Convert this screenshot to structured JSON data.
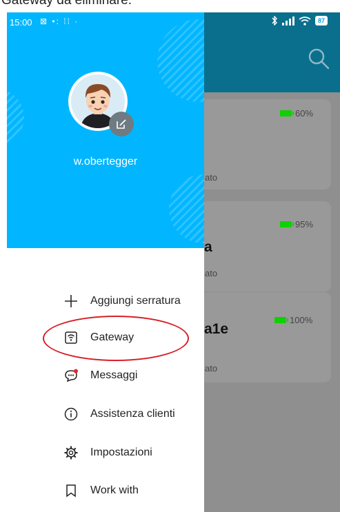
{
  "caption": {
    "text": "Gateway da eliminare."
  },
  "status_bar": {
    "time": "15:00",
    "left_icons": "⊠ •: ⁞⁞ ·",
    "battery": "87"
  },
  "background_cards": [
    {
      "battery_pct": "60%",
      "name_fragment": "",
      "status_fragment": "ato"
    },
    {
      "battery_pct": "95%",
      "name_fragment": "a",
      "status_fragment": "ato"
    },
    {
      "battery_pct": "100%",
      "name_fragment": "a1e",
      "status_fragment": "ato"
    }
  ],
  "drawer": {
    "username": "w.obertegger",
    "menu": [
      {
        "label": "Aggiungi serratura",
        "icon": "plus-icon"
      },
      {
        "label": "Gateway",
        "icon": "gateway-icon"
      },
      {
        "label": "Messaggi",
        "icon": "chat-bubble-icon"
      },
      {
        "label": "Assistenza clienti",
        "icon": "info-icon"
      },
      {
        "label": "Impostazioni",
        "icon": "gear-icon"
      },
      {
        "label": "Work with",
        "icon": "bookmark-icon"
      }
    ]
  },
  "colors": {
    "drawer_header": "#01b6ff",
    "app_header": "#0a6f8c",
    "battery_green": "#0fd000",
    "highlight_red": "#d81f26",
    "notification_dot": "#e8232a"
  }
}
